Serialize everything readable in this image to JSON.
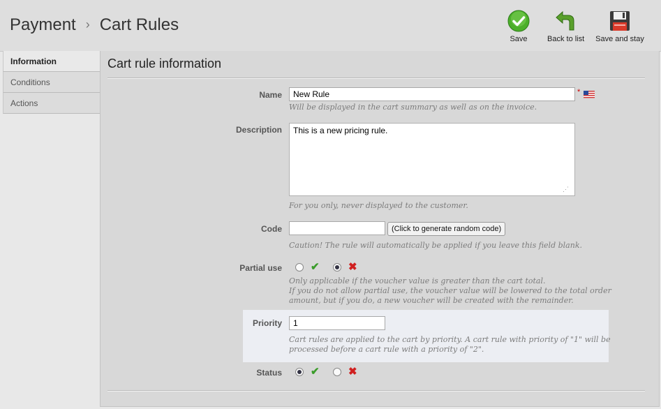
{
  "header": {
    "breadcrumb_parent": "Payment",
    "breadcrumb_separator": "›",
    "page_title": "Cart Rules"
  },
  "toolbar": {
    "save_label": "Save",
    "back_label": "Back to list",
    "save_stay_label": "Save and stay"
  },
  "tabs": [
    {
      "label": "Information",
      "active": true
    },
    {
      "label": "Conditions",
      "active": false
    },
    {
      "label": "Actions",
      "active": false
    }
  ],
  "panel": {
    "title": "Cart rule information"
  },
  "form": {
    "name": {
      "label": "Name",
      "value": "New Rule",
      "required_marker": "*",
      "hint": "Will be displayed in the cart summary as well as on the invoice."
    },
    "description": {
      "label": "Description",
      "value": "This is a new pricing rule.",
      "hint": "For you only, never displayed to the customer."
    },
    "code": {
      "label": "Code",
      "value": "",
      "button_label": "(Click to generate random code)",
      "hint": "Caution! The rule will automatically be applied if you leave this field blank."
    },
    "partial_use": {
      "label": "Partial use",
      "selected": "no",
      "hint_line1": "Only applicable if the voucher value is greater than the cart total.",
      "hint_line2": "If you do not allow partial use, the voucher value will be lowered to the total order",
      "hint_line3": "amount, but if you do, a new voucher will be created with the remainder."
    },
    "priority": {
      "label": "Priority",
      "value": "1",
      "hint_line1": "Cart rules are applied to the cart by priority. A cart rule with priority of \"1\" will be",
      "hint_line2": "processed before a cart rule with a priority of \"2\"."
    },
    "status": {
      "label": "Status",
      "selected": "yes"
    }
  },
  "icons": {
    "yes": "✔",
    "no": "✖"
  },
  "colors": {
    "save_green": "#4caf2a",
    "back_green": "#5aa02c",
    "yes_green": "#3a9c2a",
    "no_red": "#d02020"
  }
}
